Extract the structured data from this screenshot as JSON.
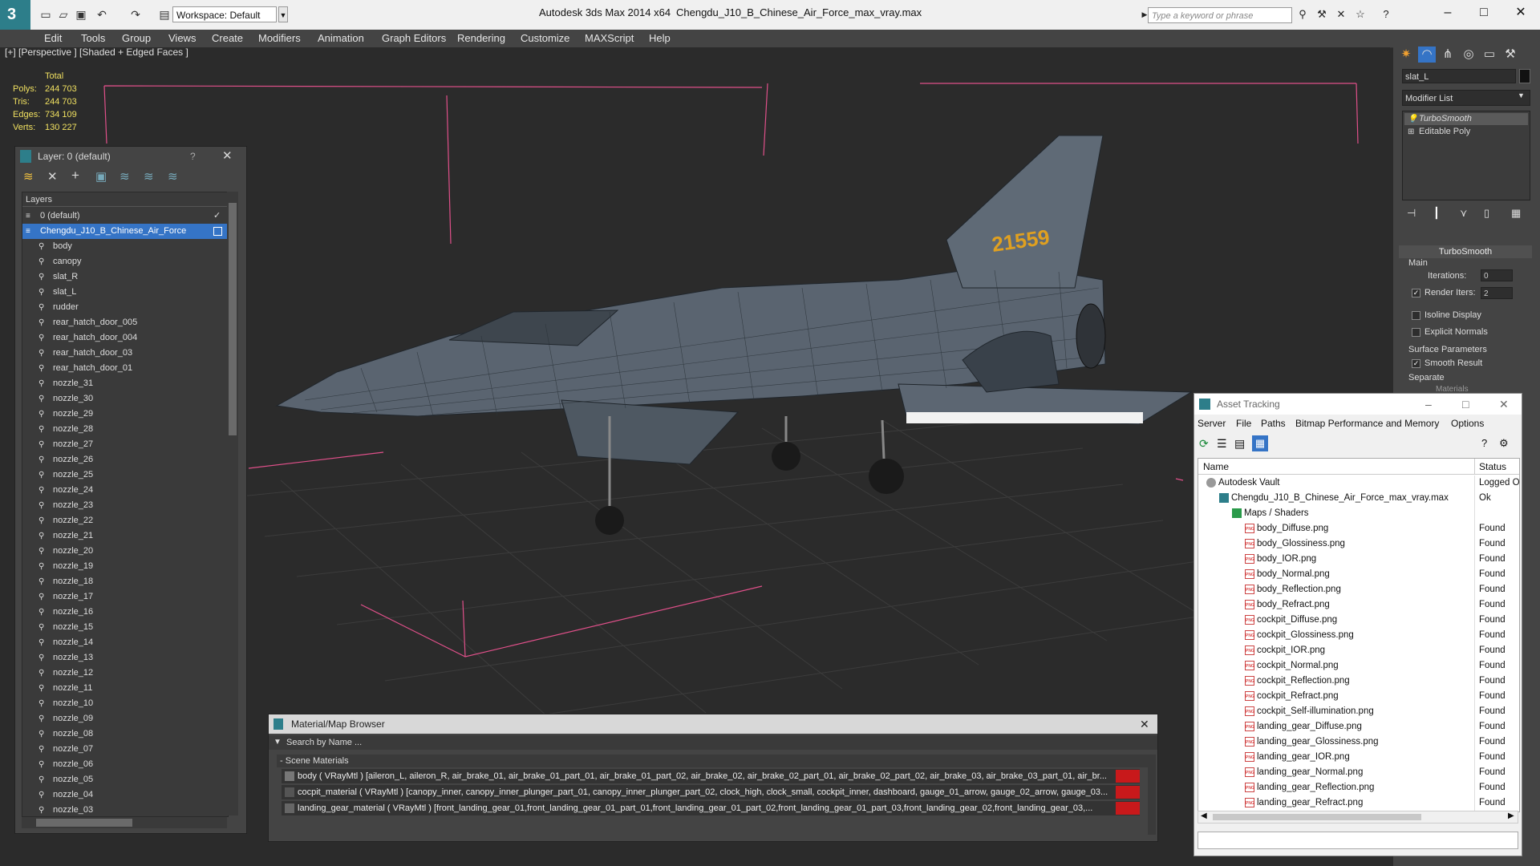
{
  "titlebar": {
    "workspace": "Workspace: Default",
    "app_title": "Autodesk 3ds Max  2014 x64",
    "file_title": "Chengdu_J10_B_Chinese_Air_Force_max_vray.max",
    "search_placeholder": "Type a keyword or phrase"
  },
  "menu": [
    "Edit",
    "Tools",
    "Group",
    "Views",
    "Create",
    "Modifiers",
    "Animation",
    "Graph Editors",
    "Rendering",
    "Customize",
    "MAXScript",
    "Help"
  ],
  "viewport": {
    "label": "[+] [Perspective ] [Shaded + Edged Faces ]",
    "stats": {
      "total_label": "Total",
      "polys_label": "Polys:",
      "polys": "244 703",
      "tris_label": "Tris:",
      "tris": "244 703",
      "edges_label": "Edges:",
      "edges": "734 109",
      "verts_label": "Verts:",
      "verts": "130 227"
    },
    "tail_number": "21559"
  },
  "command_panel": {
    "object_name": "slat_L",
    "modifier_list": "Modifier List",
    "stack": [
      "TurboSmooth",
      "Editable Poly"
    ],
    "rollout": "TurboSmooth",
    "main_label": "Main",
    "iterations_label": "Iterations:",
    "iterations": "0",
    "render_iters_label": "Render Iters:",
    "render_iters": "2",
    "isoline": "Isoline Display",
    "explicit_normals": "Explicit Normals",
    "surface_params": "Surface Parameters",
    "smooth_result": "Smooth Result",
    "separate": "Separate",
    "materials": "Materials"
  },
  "layer_window": {
    "title": "Layer: 0 (default)",
    "help": "?",
    "header": "Layers",
    "rows": [
      "0 (default)",
      "Chengdu_J10_B_Chinese_Air_Force",
      "body",
      "canopy",
      "slat_R",
      "slat_L",
      "rudder",
      "rear_hatch_door_005",
      "rear_hatch_door_004",
      "rear_hatch_door_03",
      "rear_hatch_door_01",
      "nozzle_31",
      "nozzle_30",
      "nozzle_29",
      "nozzle_28",
      "nozzle_27",
      "nozzle_26",
      "nozzle_25",
      "nozzle_24",
      "nozzle_23",
      "nozzle_22",
      "nozzle_21",
      "nozzle_20",
      "nozzle_19",
      "nozzle_18",
      "nozzle_17",
      "nozzle_16",
      "nozzle_15",
      "nozzle_14",
      "nozzle_13",
      "nozzle_12",
      "nozzle_11",
      "nozzle_10",
      "nozzle_09",
      "nozzle_08",
      "nozzle_07",
      "nozzle_06",
      "nozzle_05",
      "nozzle_04",
      "nozzle_03"
    ]
  },
  "material_browser": {
    "title": "Material/Map Browser",
    "search": "Search by Name ...",
    "group": "Scene Materials",
    "rows": [
      "body  ( VRayMtl ) [aileron_L, aileron_R, air_brake_01, air_brake_01_part_01, air_brake_01_part_02, air_brake_02, air_brake_02_part_01, air_brake_02_part_02, air_brake_03, air_brake_03_part_01, air_br...",
      "cocpit_material  ( VRayMtl ) [canopy_inner, canopy_inner_plunger_part_01, canopy_inner_plunger_part_02, clock_high, clock_small, cockpit_inner, dashboard, gauge_01_arrow, gauge_02_arrow, gauge_03...",
      "landing_gear_material  ( VRayMtl ) [front_landing_gear_01,front_landing_gear_01_part_01,front_landing_gear_01_part_02,front_landing_gear_01_part_03,front_landing_gear_02,front_landing_gear_03,..."
    ]
  },
  "asset_tracking": {
    "title": "Asset Tracking",
    "menu": [
      "Server",
      "File",
      "Paths",
      "Bitmap Performance and Memory",
      "Options"
    ],
    "col_name": "Name",
    "col_status": "Status",
    "rows": [
      {
        "name": "Autodesk Vault",
        "status": "Logged Ou",
        "level": 0
      },
      {
        "name": "Chengdu_J10_B_Chinese_Air_Force_max_vray.max",
        "status": "Ok",
        "level": 1
      },
      {
        "name": "Maps / Shaders",
        "status": "",
        "level": 2
      },
      {
        "name": "body_Diffuse.png",
        "status": "Found",
        "level": 3
      },
      {
        "name": "body_Glossiness.png",
        "status": "Found",
        "level": 3
      },
      {
        "name": "body_IOR.png",
        "status": "Found",
        "level": 3
      },
      {
        "name": "body_Normal.png",
        "status": "Found",
        "level": 3
      },
      {
        "name": "body_Reflection.png",
        "status": "Found",
        "level": 3
      },
      {
        "name": "body_Refract.png",
        "status": "Found",
        "level": 3
      },
      {
        "name": "cockpit_Diffuse.png",
        "status": "Found",
        "level": 3
      },
      {
        "name": "cockpit_Glossiness.png",
        "status": "Found",
        "level": 3
      },
      {
        "name": "cockpit_IOR.png",
        "status": "Found",
        "level": 3
      },
      {
        "name": "cockpit_Normal.png",
        "status": "Found",
        "level": 3
      },
      {
        "name": "cockpit_Reflection.png",
        "status": "Found",
        "level": 3
      },
      {
        "name": "cockpit_Refract.png",
        "status": "Found",
        "level": 3
      },
      {
        "name": "cockpit_Self-illumination.png",
        "status": "Found",
        "level": 3
      },
      {
        "name": "landing_gear_Diffuse.png",
        "status": "Found",
        "level": 3
      },
      {
        "name": "landing_gear_Glossiness.png",
        "status": "Found",
        "level": 3
      },
      {
        "name": "landing_gear_IOR.png",
        "status": "Found",
        "level": 3
      },
      {
        "name": "landing_gear_Normal.png",
        "status": "Found",
        "level": 3
      },
      {
        "name": "landing_gear_Reflection.png",
        "status": "Found",
        "level": 3
      },
      {
        "name": "landing_gear_Refract.png",
        "status": "Found",
        "level": 3
      }
    ]
  },
  "colors": {
    "accent_teal": "#2d7e8a",
    "selection_blue": "#3574c6",
    "stats_yellow": "#f0e060",
    "bbox_pink": "#e0508a",
    "material_red": "#c8191b"
  }
}
